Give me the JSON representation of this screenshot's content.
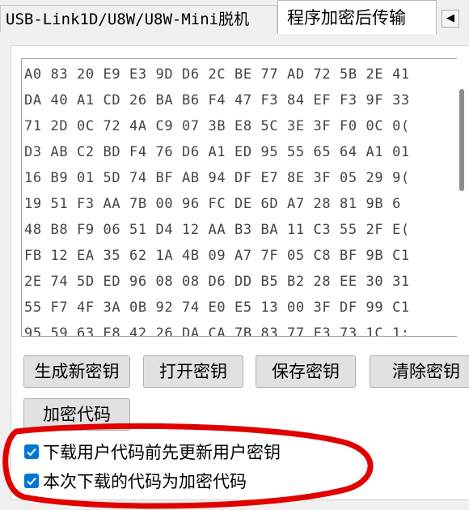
{
  "tabs": [
    {
      "label": "USB-Link1D/U8W/U8W-Mini脱机"
    },
    {
      "label": "程序加密后传输"
    }
  ],
  "tab_scroll_icon": "◀",
  "hex_lines": [
    "A0 83 20 E9 E3 9D D6 2C BE 77 AD 72 5B 2E 41",
    "DA 40 A1 CD 26 BA B6 F4 47 F3 84 EF F3 9F 33",
    "71 2D 0C 72 4A C9 07 3B E8 5C 3E 3F F0 0C 0(",
    "D3 AB C2 BD F4 76 D6 A1 ED 95 55 65 64 A1 01",
    "16 B9 01 5D 74 BF AB 94 DF E7 8E 3F 05 29 9(",
    "19 51 F3 AA 7B 00 96 FC DE 6D A7 28 81 9B 6",
    "48 B8 F9 06 51 D4 12 AA B3 BA 11 C3 55 2F E(",
    "FB 12 EA 35 62 1A 4B 09 A7 7F 05 C8 BF 9B C1",
    "2E 74 5D ED 96 08 08 D6 DD B5 B2 28 EE 30 31",
    "55 F7 4F 3A 0B 92 74 E0 E5 13 00 3F DF 99 C1",
    "95 59 63 E8 42 26 DA CA 7B 83 77 F3 73 1C 1:"
  ],
  "buttons": {
    "generate_key": "生成新密钥",
    "open_key": "打开密钥",
    "save_key": "保存密钥",
    "clear_key": "清除密钥",
    "encrypt_code": "加密代码"
  },
  "checkboxes": [
    {
      "label": "下载用户代码前先更新用户密钥",
      "checked": true
    },
    {
      "label": "本次下载的代码为加密代码",
      "checked": true
    }
  ],
  "colors": {
    "checkbox": "#0078d7",
    "annotation": "#e00000"
  }
}
